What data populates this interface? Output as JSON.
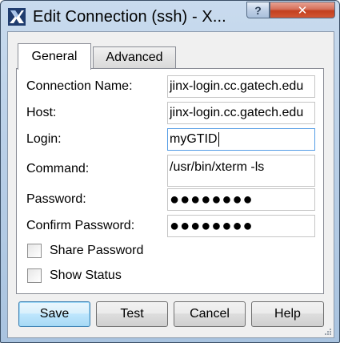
{
  "window": {
    "title": "Edit Connection (ssh) - X...",
    "help_glyph": "?",
    "close_glyph": "✕",
    "icon": "app-x-icon"
  },
  "tabs": [
    {
      "label": "General",
      "selected": true
    },
    {
      "label": "Advanced",
      "selected": false
    }
  ],
  "form": {
    "connection_name": {
      "label": "Connection Name:",
      "value": "jinx-login.cc.gatech.edu"
    },
    "host": {
      "label": "Host:",
      "value": "jinx-login.cc.gatech.edu"
    },
    "login": {
      "label": "Login:",
      "value": "myGTID"
    },
    "command": {
      "label": "Command:",
      "value": "/usr/bin/xterm -ls"
    },
    "password": {
      "label": "Password:",
      "value": "●●●●●●●●"
    },
    "confirm_password": {
      "label": "Confirm Password:",
      "value": "●●●●●●●●"
    }
  },
  "checkboxes": {
    "share_password": {
      "label": "Share Password",
      "checked": false
    },
    "show_status": {
      "label": "Show Status",
      "checked": false
    }
  },
  "buttons": {
    "save": "Save",
    "test": "Test",
    "cancel": "Cancel",
    "help": "Help"
  },
  "colors": {
    "focus_border": "#569de5",
    "default_button_border": "#3c7fb1",
    "close_button": "#c3401f"
  }
}
